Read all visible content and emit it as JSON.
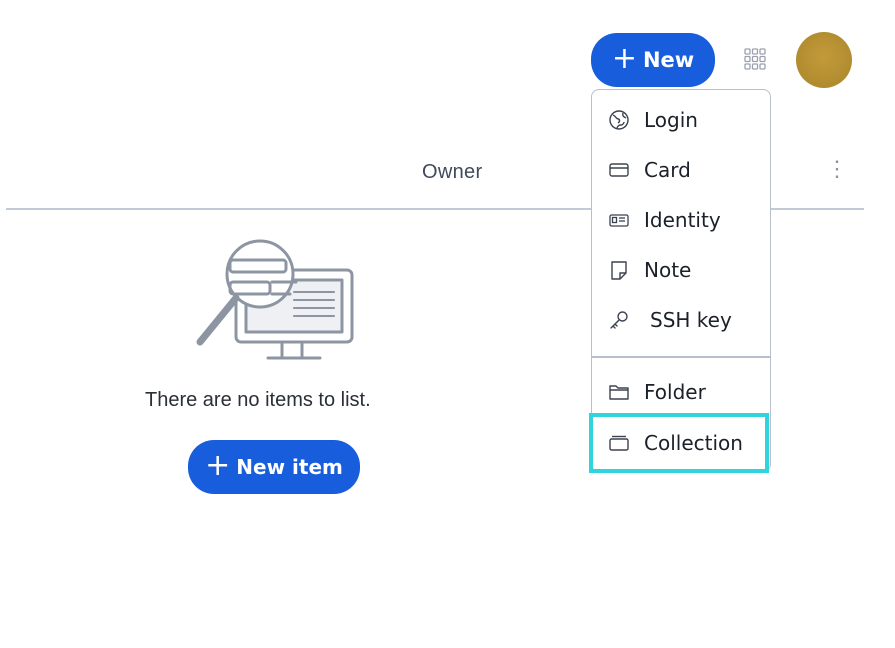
{
  "topbar": {
    "new_button_label": "New",
    "apps_icon": "grid-icon",
    "avatar_color": "#b8902f"
  },
  "table": {
    "owner_header": "Owner",
    "options_icon": "kebab-icon"
  },
  "empty_state": {
    "message": "There are no items to list.",
    "new_item_label": "New item"
  },
  "new_menu": {
    "items": [
      {
        "label": "Login",
        "icon": "globe-icon"
      },
      {
        "label": "Card",
        "icon": "credit-card-icon"
      },
      {
        "label": "Identity",
        "icon": "id-card-icon"
      },
      {
        "label": "Note",
        "icon": "sticky-note-icon"
      },
      {
        "label": "SSH key",
        "icon": "key-icon"
      }
    ],
    "secondary": [
      {
        "label": "Folder",
        "icon": "folder-icon"
      },
      {
        "label": "Collection",
        "icon": "collection-icon"
      }
    ]
  },
  "colors": {
    "primary": "#175ddc",
    "highlight": "#2fd4dc"
  }
}
